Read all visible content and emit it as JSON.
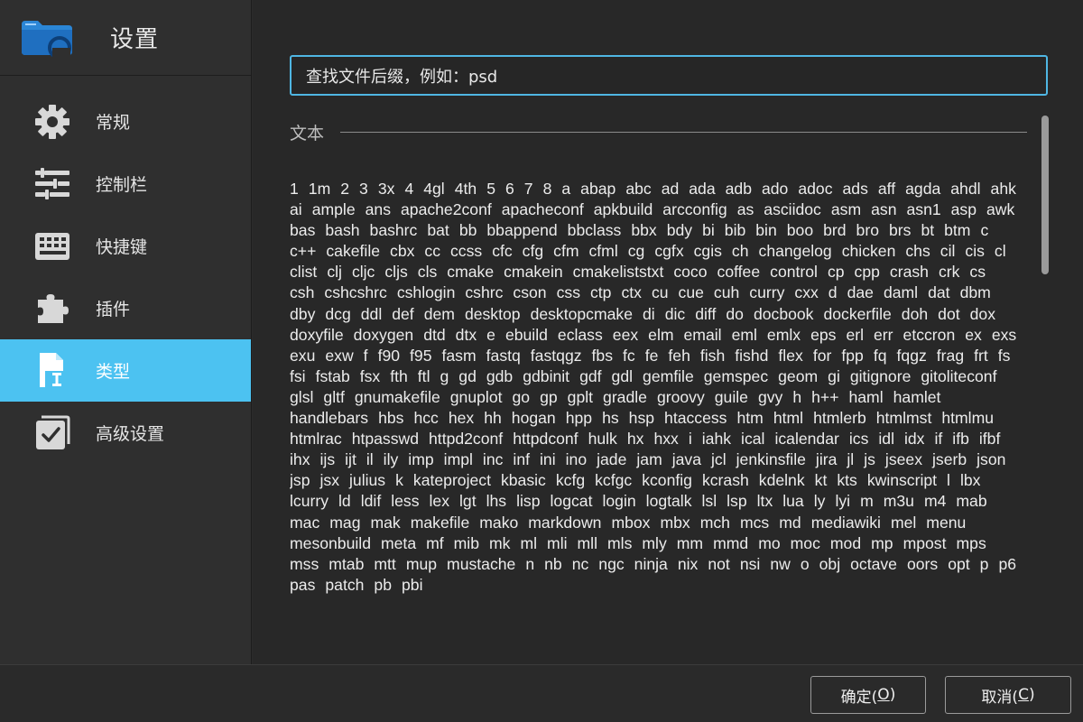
{
  "sidebar": {
    "title": "设置",
    "items": [
      {
        "label": "常规",
        "icon": "gear-icon"
      },
      {
        "label": "控制栏",
        "icon": "sliders-icon"
      },
      {
        "label": "快捷键",
        "icon": "keyboard-icon"
      },
      {
        "label": "插件",
        "icon": "puzzle-icon"
      },
      {
        "label": "类型",
        "icon": "file-type-icon",
        "active": true
      },
      {
        "label": "高级设置",
        "icon": "checkbox-icon"
      }
    ]
  },
  "search": {
    "value": "查找文件后缀，例如：psd"
  },
  "section": {
    "title": "文本"
  },
  "types": [
    "1",
    "1m",
    "2",
    "3",
    "3x",
    "4",
    "4gl",
    "4th",
    "5",
    "6",
    "7",
    "8",
    "a",
    "abap",
    "abc",
    "ad",
    "ada",
    "adb",
    "ado",
    "adoc",
    "ads",
    "aff",
    "agda",
    "ahdl",
    "ahk",
    "ai",
    "ample",
    "ans",
    "apache2conf",
    "apacheconf",
    "apkbuild",
    "arcconfig",
    "as",
    "asciidoc",
    "asm",
    "asn",
    "asn1",
    "asp",
    "awk",
    "bas",
    "bash",
    "bashrc",
    "bat",
    "bb",
    "bbappend",
    "bbclass",
    "bbx",
    "bdy",
    "bi",
    "bib",
    "bin",
    "boo",
    "brd",
    "bro",
    "brs",
    "bt",
    "btm",
    "c",
    "c++",
    "cakefile",
    "cbx",
    "cc",
    "ccss",
    "cfc",
    "cfg",
    "cfm",
    "cfml",
    "cg",
    "cgfx",
    "cgis",
    "ch",
    "changelog",
    "chicken",
    "chs",
    "cil",
    "cis",
    "cl",
    "clist",
    "clj",
    "cljc",
    "cljs",
    "cls",
    "cmake",
    "cmakein",
    "cmakeliststxt",
    "coco",
    "coffee",
    "control",
    "cp",
    "cpp",
    "crash",
    "crk",
    "cs",
    "csh",
    "cshcshrc",
    "cshlogin",
    "cshrc",
    "cson",
    "css",
    "ctp",
    "ctx",
    "cu",
    "cue",
    "cuh",
    "curry",
    "cxx",
    "d",
    "dae",
    "daml",
    "dat",
    "dbm",
    "dby",
    "dcg",
    "ddl",
    "def",
    "dem",
    "desktop",
    "desktopcmake",
    "di",
    "dic",
    "diff",
    "do",
    "docbook",
    "dockerfile",
    "doh",
    "dot",
    "dox",
    "doxyfile",
    "doxygen",
    "dtd",
    "dtx",
    "e",
    "ebuild",
    "eclass",
    "eex",
    "elm",
    "email",
    "eml",
    "emlx",
    "eps",
    "erl",
    "err",
    "etccron",
    "ex",
    "exs",
    "exu",
    "exw",
    "f",
    "f90",
    "f95",
    "fasm",
    "fastq",
    "fastqgz",
    "fbs",
    "fc",
    "fe",
    "feh",
    "fish",
    "fishd",
    "flex",
    "for",
    "fpp",
    "fq",
    "fqgz",
    "frag",
    "frt",
    "fs",
    "fsi",
    "fstab",
    "fsx",
    "fth",
    "ftl",
    "g",
    "gd",
    "gdb",
    "gdbinit",
    "gdf",
    "gdl",
    "gemfile",
    "gemspec",
    "geom",
    "gi",
    "gitignore",
    "gitoliteconf",
    "glsl",
    "gltf",
    "gnumakefile",
    "gnuplot",
    "go",
    "gp",
    "gplt",
    "gradle",
    "groovy",
    "guile",
    "gvy",
    "h",
    "h++",
    "haml",
    "hamlet",
    "handlebars",
    "hbs",
    "hcc",
    "hex",
    "hh",
    "hogan",
    "hpp",
    "hs",
    "hsp",
    "htaccess",
    "htm",
    "html",
    "htmlerb",
    "htmlmst",
    "htmlmu",
    "htmlrac",
    "htpasswd",
    "httpd2conf",
    "httpdconf",
    "hulk",
    "hx",
    "hxx",
    "i",
    "iahk",
    "ical",
    "icalendar",
    "ics",
    "idl",
    "idx",
    "if",
    "ifb",
    "ifbf",
    "ihx",
    "ijs",
    "ijt",
    "il",
    "ily",
    "imp",
    "impl",
    "inc",
    "inf",
    "ini",
    "ino",
    "jade",
    "jam",
    "java",
    "jcl",
    "jenkinsfile",
    "jira",
    "jl",
    "js",
    "jseex",
    "jserb",
    "json",
    "jsp",
    "jsx",
    "julius",
    "k",
    "kateproject",
    "kbasic",
    "kcfg",
    "kcfgc",
    "kconfig",
    "kcrash",
    "kdelnk",
    "kt",
    "kts",
    "kwinscript",
    "l",
    "lbx",
    "lcurry",
    "ld",
    "ldif",
    "less",
    "lex",
    "lgt",
    "lhs",
    "lisp",
    "logcat",
    "login",
    "logtalk",
    "lsl",
    "lsp",
    "ltx",
    "lua",
    "ly",
    "lyi",
    "m",
    "m3u",
    "m4",
    "mab",
    "mac",
    "mag",
    "mak",
    "makefile",
    "mako",
    "markdown",
    "mbox",
    "mbx",
    "mch",
    "mcs",
    "md",
    "mediawiki",
    "mel",
    "menu",
    "mesonbuild",
    "meta",
    "mf",
    "mib",
    "mk",
    "ml",
    "mli",
    "mll",
    "mls",
    "mly",
    "mm",
    "mmd",
    "mo",
    "moc",
    "mod",
    "mp",
    "mpost",
    "mps",
    "mss",
    "mtab",
    "mtt",
    "mup",
    "mustache",
    "n",
    "nb",
    "nc",
    "ngc",
    "ninja",
    "nix",
    "not",
    "nsi",
    "nw",
    "o",
    "obj",
    "octave",
    "oors",
    "opt",
    "p",
    "p6",
    "pas",
    "patch",
    "pb",
    "pbi"
  ],
  "footer": {
    "ok_text": "确定(",
    "ok_key": "O",
    "ok_end": ")",
    "cancel_text": "取消(",
    "cancel_key": "C",
    "cancel_end": ")"
  },
  "colors": {
    "accent": "#4cc2f1",
    "search_border": "#4fb6e3",
    "sidebar_bg": "#2f2f2f",
    "main_bg": "#282828"
  }
}
